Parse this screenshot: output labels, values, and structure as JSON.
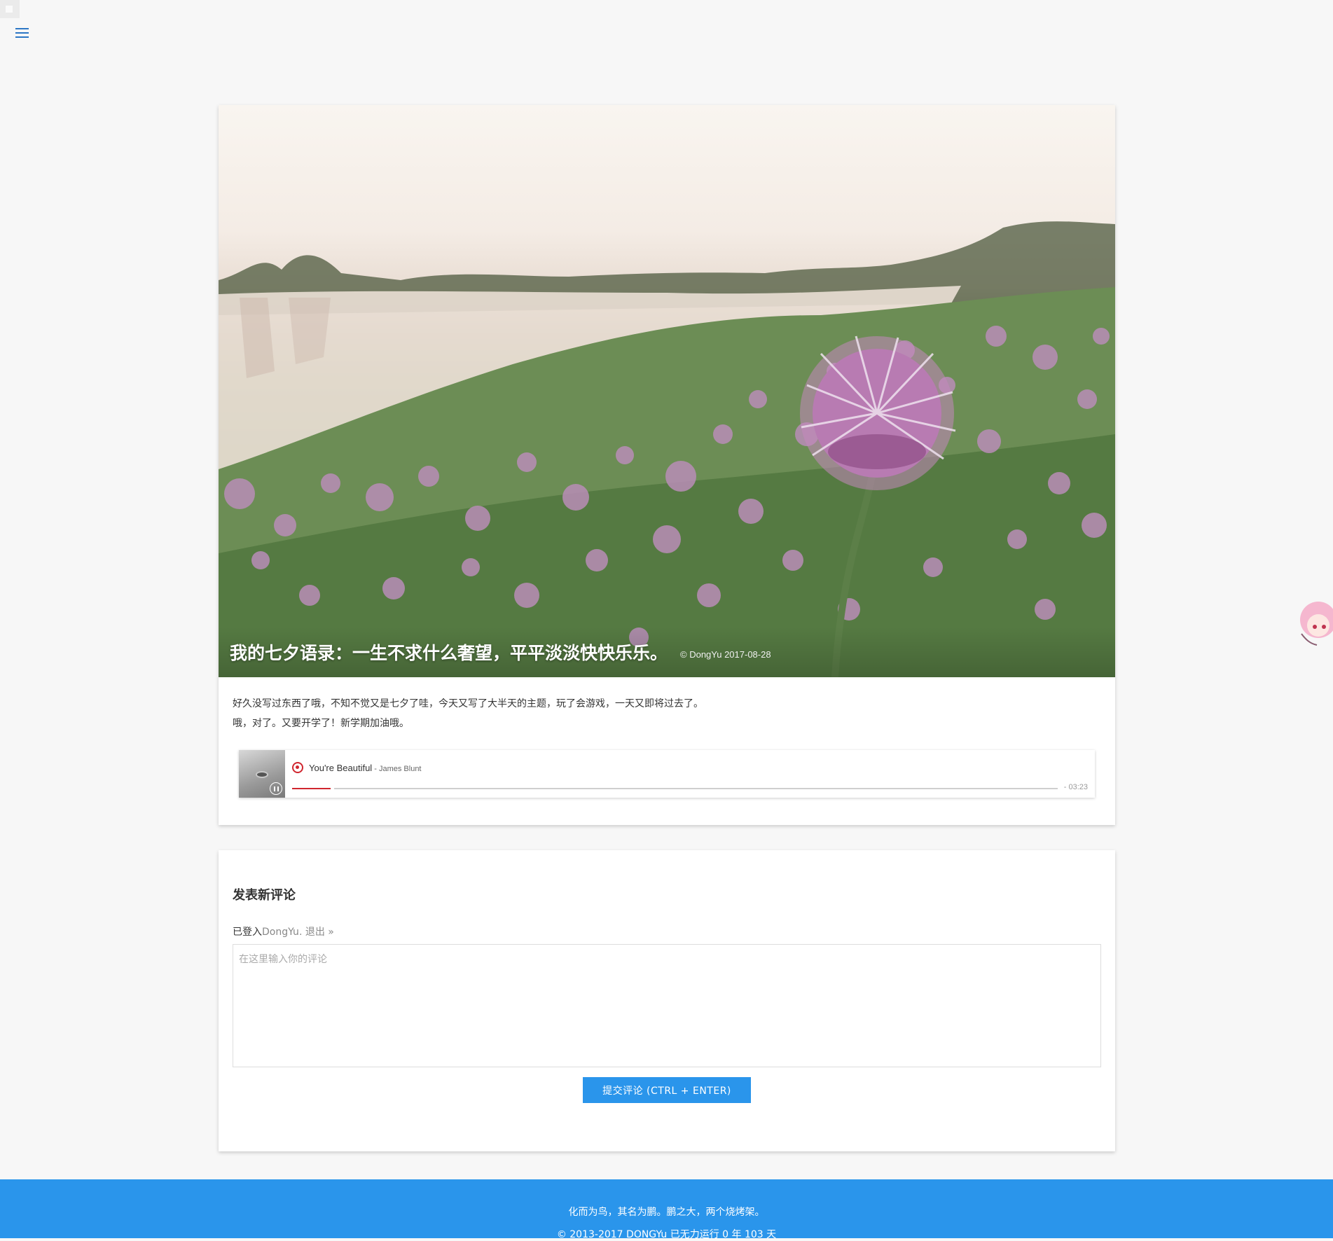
{
  "post": {
    "title": "我的七夕语录：一生不求什么奢望，平平淡淡快快乐乐。",
    "meta": "© DongYu 2017-08-28",
    "paragraphs": [
      "好久没写过东西了哦，不知不觉又是七夕了哇，今天又写了大半天的主题，玩了会游戏，一天又即将过去了。",
      "哦，对了。又要开学了！新学期加油哦。"
    ]
  },
  "player": {
    "song_title": "You're Beautiful",
    "song_artist": " - James Blunt",
    "time": "- 03:23",
    "progress": 0.05,
    "accent": "#d0262f"
  },
  "comments": {
    "heading": "发表新评论",
    "login_prefix": "已登入",
    "login_user": "DongYu",
    "logout_label": ". 退出 »",
    "placeholder": "在这里输入你的评论",
    "submit_label": "提交评论 (CTRL + ENTER)"
  },
  "footer": {
    "motto": "化而为鸟，其名为鹏。鹏之大，两个烧烤架。",
    "copyright": "© 2013-2017 DONGYu 已无力运行 0 年 103 天",
    "color": "#2a95eb"
  },
  "icons": {
    "menu": "hamburger-menu-icon",
    "player_brand": "netease-music-icon",
    "pause": "pause-icon"
  }
}
